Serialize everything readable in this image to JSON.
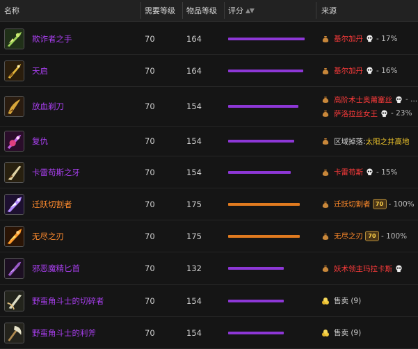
{
  "header": {
    "name": "名称",
    "req_level": "需要等级",
    "item_level": "物品等级",
    "rating": "评分",
    "source": "来源"
  },
  "colors": {
    "epic": "#a93ff0",
    "legendary": "#ff8b2e",
    "boss_red": "#ff3b3b",
    "gold": "#f0c62b"
  },
  "rows": [
    {
      "name": "欺诈者之手",
      "quality": "epic",
      "req": "70",
      "ilvl": "164",
      "rating": 1.0,
      "icon": "green-claw-icon",
      "sources": [
        {
          "bag": true,
          "text": "基尔加丹",
          "color": "red",
          "skull": true,
          "suffix": " - 17%"
        }
      ]
    },
    {
      "name": "天启",
      "quality": "epic",
      "req": "70",
      "ilvl": "164",
      "rating": 0.98,
      "icon": "golden-dagger-icon",
      "sources": [
        {
          "bag": true,
          "text": "基尔加丹",
          "color": "red",
          "skull": true,
          "suffix": " - 16%"
        }
      ]
    },
    {
      "name": "放血剃刀",
      "quality": "epic",
      "req": "70",
      "ilvl": "154",
      "rating": 0.92,
      "icon": "curved-blade-icon",
      "sources": [
        {
          "bag": true,
          "text": "高阶术士奥莆塞丝",
          "color": "red",
          "skull": true,
          "suffix": " - ..."
        },
        {
          "bag": true,
          "text": "萨洛拉丝女王",
          "color": "red",
          "skull": true,
          "suffix": " - 23%"
        }
      ]
    },
    {
      "name": "复仇",
      "quality": "epic",
      "req": "70",
      "ilvl": "154",
      "rating": 0.86,
      "icon": "purple-sword-icon",
      "sources": [
        {
          "bag": true,
          "text": "太阳之井高地",
          "color": "gold",
          "skull": false,
          "prefix": "区域掉落: ",
          "suffix": ""
        }
      ]
    },
    {
      "name": "卡雷苟斯之牙",
      "quality": "epic",
      "req": "70",
      "ilvl": "154",
      "rating": 0.82,
      "icon": "fang-blade-icon",
      "sources": [
        {
          "bag": true,
          "text": "卡雷苟斯",
          "color": "red",
          "skull": true,
          "suffix": " - 15%"
        }
      ]
    },
    {
      "name": "迁跃切割者",
      "quality": "legendary",
      "req": "70",
      "ilvl": "175",
      "rating": 0.94,
      "icon": "warp-slicer-icon",
      "sources": [
        {
          "bag": true,
          "text": "迁跃切割者",
          "color": "orange",
          "skull": false,
          "badge": "70",
          "suffix": " - 100%"
        }
      ]
    },
    {
      "name": "无尽之刃",
      "quality": "legendary",
      "req": "70",
      "ilvl": "175",
      "rating": 0.94,
      "icon": "infinity-blade-icon",
      "sources": [
        {
          "bag": true,
          "text": "无尽之刃",
          "color": "orange",
          "skull": false,
          "badge": "70",
          "suffix": " - 100%"
        }
      ]
    },
    {
      "name": "邪恶魔精匕首",
      "quality": "epic",
      "req": "70",
      "ilvl": "132",
      "rating": 0.73,
      "icon": "fel-dagger-icon",
      "sources": [
        {
          "bag": true,
          "text": "妖术领主玛拉卡斯",
          "color": "red",
          "skull": true,
          "suffix": ""
        }
      ]
    },
    {
      "name": "野蛮角斗士的切碎者",
      "quality": "epic",
      "req": "70",
      "ilvl": "154",
      "rating": 0.73,
      "icon": "gladiator-blade-icon",
      "sources": [
        {
          "bag": false,
          "gold_icon": true,
          "text": "售卖 (9)",
          "color": "grey",
          "skull": false,
          "suffix": ""
        }
      ]
    },
    {
      "name": "野蛮角斗士的利斧",
      "quality": "epic",
      "req": "70",
      "ilvl": "154",
      "rating": 0.73,
      "icon": "gladiator-axe-icon",
      "sources": [
        {
          "bag": false,
          "gold_icon": true,
          "text": "售卖 (9)",
          "color": "grey",
          "skull": false,
          "suffix": ""
        }
      ]
    }
  ]
}
